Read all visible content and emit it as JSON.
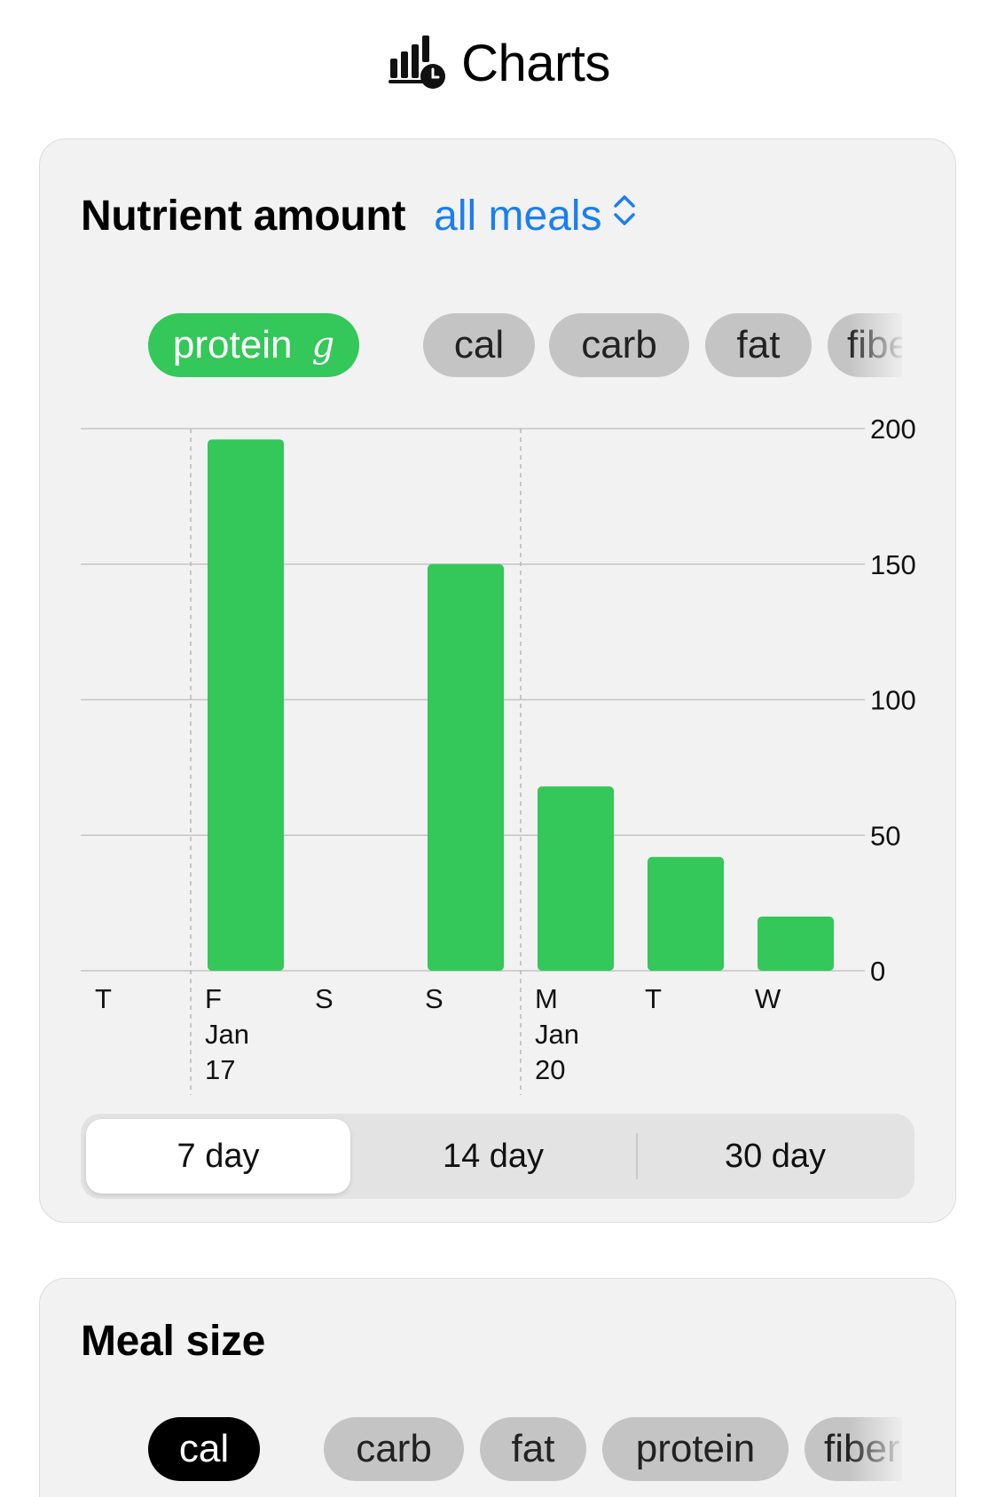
{
  "header": {
    "title": "Charts",
    "icon": "chart-clock-icon"
  },
  "nutrient_card": {
    "title": "Nutrient amount",
    "meal_filter": "all meals",
    "pills": [
      {
        "label": "protein",
        "unit": "g",
        "active": true
      },
      {
        "label": "cal",
        "active": false
      },
      {
        "label": "carb",
        "active": false
      },
      {
        "label": "fat",
        "active": false
      },
      {
        "label": "fiber",
        "active": false
      }
    ],
    "range_tabs": [
      {
        "label": "7 day",
        "selected": true
      },
      {
        "label": "14 day",
        "selected": false
      },
      {
        "label": "30 day",
        "selected": false
      }
    ]
  },
  "meal_size_card": {
    "title": "Meal size",
    "pills": [
      {
        "label": "cal",
        "active": true
      },
      {
        "label": "carb",
        "active": false
      },
      {
        "label": "fat",
        "active": false
      },
      {
        "label": "protein",
        "active": false
      },
      {
        "label": "fiber",
        "active": false
      }
    ]
  },
  "colors": {
    "accent_green": "#34c759",
    "link_blue": "#1a7ff0",
    "pill_inactive": "#c4c4c4"
  },
  "chart_data": {
    "type": "bar",
    "categories": [
      "T",
      "F",
      "S",
      "S",
      "M",
      "T",
      "W"
    ],
    "date_labels": [
      {
        "index": 1,
        "month": "Jan",
        "day": "17"
      },
      {
        "index": 4,
        "month": "Jan",
        "day": "20"
      }
    ],
    "values": [
      0,
      196,
      0,
      150,
      68,
      42,
      20
    ],
    "yticks": [
      "0",
      "50",
      "100",
      "150",
      "200"
    ],
    "ylim": [
      0,
      200
    ],
    "y_axis_position": "right",
    "grid": true
  }
}
